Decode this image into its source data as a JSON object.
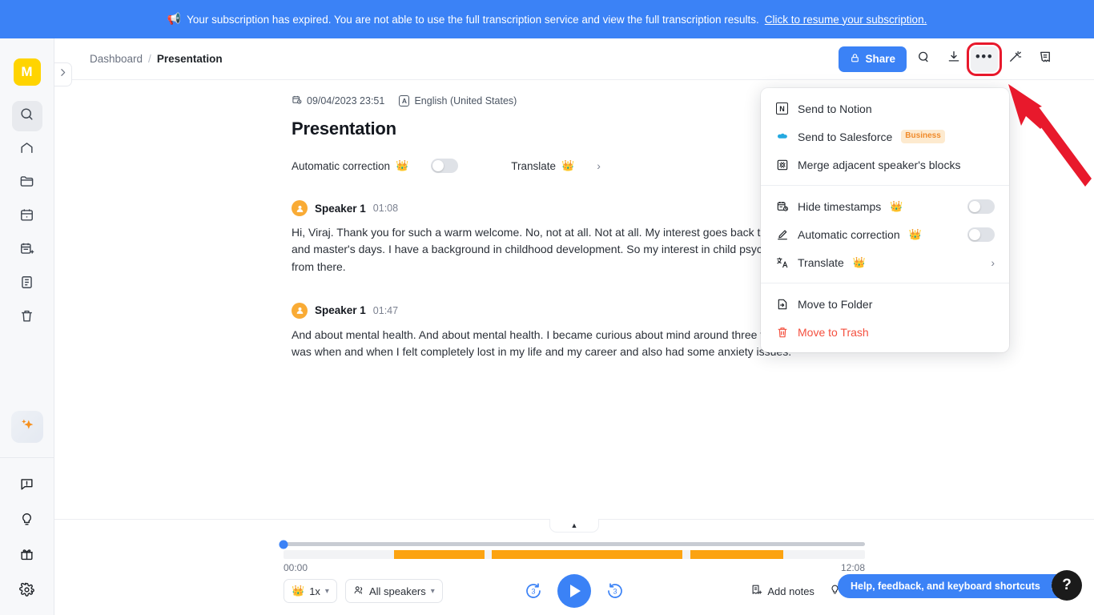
{
  "banner": {
    "icon": "megaphone-icon",
    "text": "Your subscription has expired. You are not able to use the full transcription service and view the full transcription results.",
    "link": "Click to resume your subscription."
  },
  "sidebar": {
    "avatar_initial": "M",
    "avatar_color": "#ffd400",
    "top_items": [
      {
        "name": "search-icon",
        "active": true
      },
      {
        "name": "home-icon",
        "active": false
      },
      {
        "name": "folder-icon",
        "active": false
      },
      {
        "name": "calendar-icon",
        "active": false
      },
      {
        "name": "calendar-add-icon",
        "active": false
      },
      {
        "name": "notes-icon",
        "active": false
      },
      {
        "name": "trash-icon",
        "active": false
      }
    ],
    "ai_button": "sparkle-icon",
    "bottom_items": [
      {
        "name": "feedback-icon"
      },
      {
        "name": "tips-icon"
      },
      {
        "name": "gift-icon"
      },
      {
        "name": "settings-icon"
      }
    ]
  },
  "header": {
    "breadcrumb_root": "Dashboard",
    "breadcrumb_separator": "/",
    "breadcrumb_current": "Presentation",
    "share_label": "Share",
    "actions": [
      {
        "name": "search-icon"
      },
      {
        "name": "download-icon"
      },
      {
        "name": "more-options-icon"
      },
      {
        "name": "magic-wand-icon"
      },
      {
        "name": "notes-panel-icon"
      }
    ],
    "highlight_color": "#e8192c"
  },
  "document": {
    "date": "09/04/2023 23:51",
    "language": "English (United States)",
    "language_badge": "A",
    "title": "Presentation",
    "tools": {
      "auto_correction_label": "Automatic correction",
      "auto_correction_on": false,
      "translate_label": "Translate"
    },
    "blocks": [
      {
        "speaker": "Speaker 1",
        "time": "01:08",
        "text": "Hi, Viraj. Thank you for such a warm welcome. No, not at all. Not at all. My interest goes back to my bachelor's and master's days. I have a background in childhood development. So my interest in child psychology comes from there."
      },
      {
        "speaker": "Speaker 1",
        "time": "01:47",
        "text": "And about mental health. And about mental health. I became curious about mind around three to four. When I was when and when I felt completely lost in my life and my career and also had some anxiety issues."
      }
    ]
  },
  "menu": {
    "groups": [
      {
        "items": [
          {
            "label": "Send to Notion",
            "icon": "notion-icon",
            "type": "plain"
          },
          {
            "label": "Send to Salesforce",
            "icon": "salesforce-icon",
            "type": "plain",
            "badge": "Business"
          },
          {
            "label": "Merge adjacent speaker's blocks",
            "icon": "merge-icon",
            "type": "plain"
          }
        ]
      },
      {
        "items": [
          {
            "label": "Hide timestamps",
            "icon": "timestamp-icon",
            "type": "toggle",
            "crown": true,
            "value": false
          },
          {
            "label": "Automatic correction",
            "icon": "pencil-icon",
            "type": "toggle",
            "crown": true,
            "value": false
          },
          {
            "label": "Translate",
            "icon": "translate-icon",
            "type": "submenu",
            "crown": true
          }
        ]
      },
      {
        "items": [
          {
            "label": "Move to Folder",
            "icon": "move-folder-icon",
            "type": "plain"
          },
          {
            "label": "Move to Trash",
            "icon": "trash-icon",
            "type": "danger"
          }
        ]
      }
    ]
  },
  "player": {
    "current_time": "00:00",
    "total_time": "12:08",
    "progress_percent": 0,
    "speed_label": "1x",
    "speakers_label": "All speakers",
    "skip_back_label": "3",
    "skip_forward_label": "3",
    "add_notes_label": "Add notes",
    "tips_label": "Tips",
    "waveform_segments": [
      {
        "left_percent": 19.0,
        "width_percent": 15.6
      },
      {
        "left_percent": 35.8,
        "width_percent": 32.8
      },
      {
        "left_percent": 70.0,
        "width_percent": 15.9
      }
    ]
  },
  "help": {
    "bar_text": "Help, feedback, and keyboard shortcuts",
    "close_icon": "close-icon",
    "fab_label": "?"
  }
}
